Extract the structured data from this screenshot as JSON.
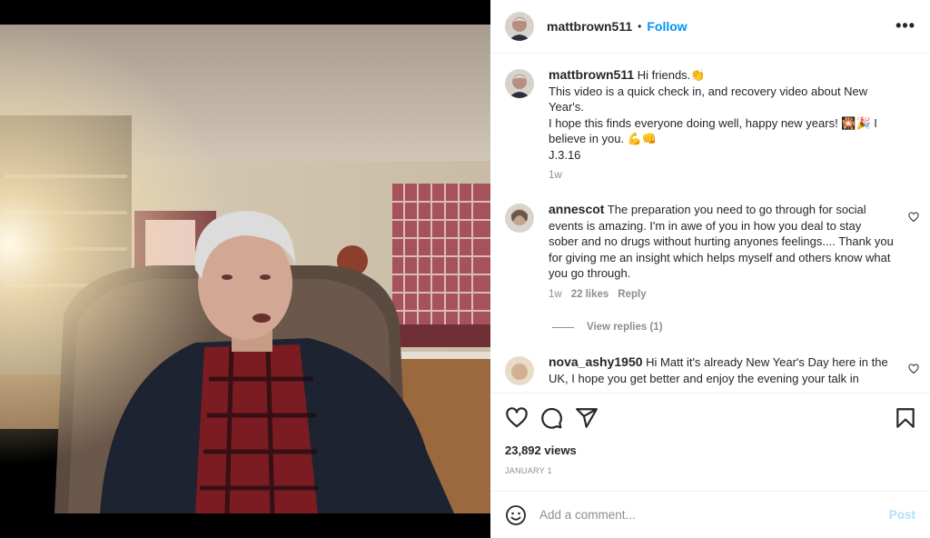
{
  "header": {
    "username": "mattbrown511",
    "separator": "•",
    "follow_label": "Follow",
    "more_label": "•••"
  },
  "caption": {
    "username": "mattbrown511",
    "lines": [
      "Hi friends.👏",
      "This video is a quick check in, and recovery video about New Year's.",
      "I hope this finds everyone doing well, happy new years! 🎇🎉 I believe in you. 💪👊",
      "J.3.16"
    ],
    "time": "1w"
  },
  "comments": [
    {
      "username": "annescot",
      "text": "The preparation you need to go through for social events is amazing. I'm in awe of you in how you deal to stay sober and no drugs without hurting anyones feelings.... Thank you for giving me an insight which helps myself and others know what you go through.",
      "time": "1w",
      "likes": "22 likes",
      "reply_label": "Reply",
      "view_replies": "View replies (1)"
    },
    {
      "username": "nova_ashy1950",
      "text": "Hi Matt it's already New Year's Day here in the UK, I hope you get better and enjoy the evening your talk in"
    }
  ],
  "stats": {
    "views": "23,892 views",
    "date": "JANUARY 1"
  },
  "comment_box": {
    "placeholder": "Add a comment...",
    "post_label": "Post"
  },
  "icons": {
    "like": "heart-icon",
    "comment": "comment-icon",
    "share": "share-icon",
    "save": "bookmark-icon",
    "emoji": "emoji-icon",
    "more": "more-icon"
  },
  "colors": {
    "follow": "#0095f6",
    "post_disabled": "#b2dffc",
    "muted": "#8e8e8e",
    "text": "#262626"
  }
}
